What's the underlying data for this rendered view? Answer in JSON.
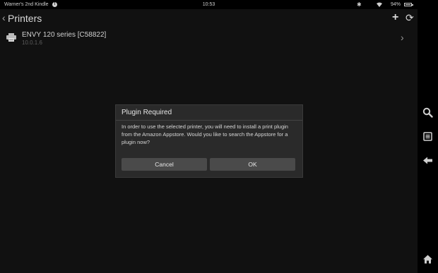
{
  "status_bar": {
    "device_name": "Warner's 2nd Kindle",
    "info_glyph": "!",
    "time": "10:53",
    "bluetooth_glyph": "✱",
    "battery_percent": "94%",
    "battery_level": 0.94
  },
  "title_bar": {
    "back_glyph": "‹",
    "title": "Printers",
    "add_glyph": "+",
    "refresh_glyph": "⟳"
  },
  "printers": [
    {
      "name": "ENVY 120 series [C58822]",
      "address": "10.0.1.6",
      "chevron_glyph": "›"
    }
  ],
  "dialog": {
    "title": "Plugin Required",
    "message": "In order to use the selected printer, you will need to install a print plugin from the Amazon Appstore. Would you like to search the Appstore for a plugin now?",
    "cancel_label": "Cancel",
    "ok_label": "OK"
  },
  "nav_bar": {
    "icons": [
      "search-icon",
      "menu-icon",
      "back-icon",
      "home-icon"
    ]
  },
  "colors": {
    "background": "#111111",
    "dialog_background": "#2a2a2a",
    "button_background": "#4a4a4a"
  }
}
